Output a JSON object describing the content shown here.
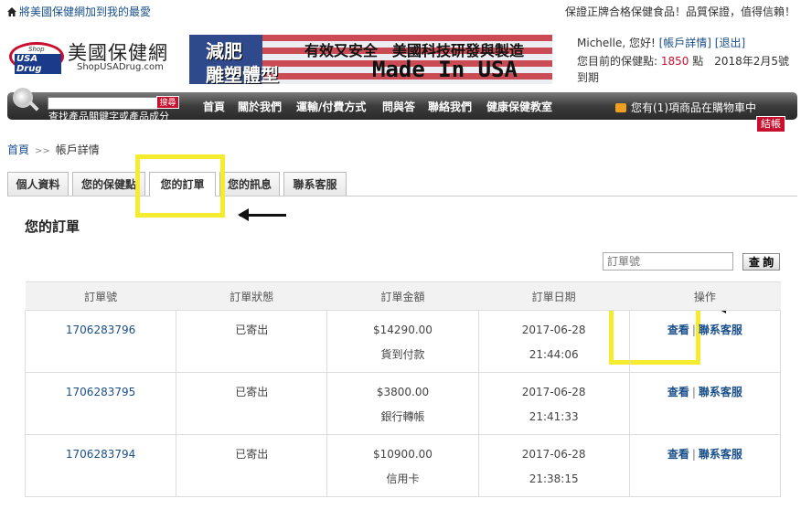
{
  "topbar": {
    "favorite_link": "將美國保健網加到我的最愛",
    "slogan": "保證正牌合格保健食品！品質保證，值得信賴！"
  },
  "logo": {
    "badge_shop": "Shop",
    "badge_usa": "USA Drug",
    "name": "美國保健網",
    "url": "ShopUSADrug.com"
  },
  "banner": {
    "line1": "減肥",
    "line2": "雕塑體型",
    "tag1": "有效又安全",
    "tag2": "美國科技研發與製造",
    "made_in": "Made In USA"
  },
  "user": {
    "greeting": "Michelle, 您好!",
    "account_link": "[帳戶詳情]",
    "logout_link": "[退出]",
    "points_label": "您目前的保健點:",
    "points_value": "1850",
    "points_suffix": "點　2018年2月5號到期"
  },
  "search": {
    "placeholder": "",
    "button": "搜尋",
    "hint": "查找產品關鍵字或產品成分"
  },
  "nav": [
    {
      "label": "首頁"
    },
    {
      "label": "關於我們"
    },
    {
      "label": "運輸/付費方式"
    },
    {
      "label": "問與答"
    },
    {
      "label": "聯絡我們"
    },
    {
      "label": "健康保健教室"
    }
  ],
  "cart": {
    "text": "您有(1)項商品在購物車中",
    "checkout": "結帳"
  },
  "breadcrumb": {
    "home": "首頁",
    "sep": ">>",
    "current": "帳戶詳情"
  },
  "tabs": [
    {
      "label": "個人資料"
    },
    {
      "label": "您的保健點"
    },
    {
      "label": "您的訂單"
    },
    {
      "label": "您的訊息"
    },
    {
      "label": "聯系客服"
    }
  ],
  "orders": {
    "title": "您的訂單",
    "search_placeholder": "訂單號",
    "query_button": "查 詢",
    "columns": [
      "訂單號",
      "訂單狀態",
      "訂單金額",
      "訂單日期",
      "操作"
    ],
    "rows": [
      {
        "id": "1706283796",
        "status": "已寄出",
        "amount": "$14290.00",
        "payment": "貨到付款",
        "date": "2017-06-28",
        "time": "21:44:06",
        "view": "查看",
        "contact": "聯系客服"
      },
      {
        "id": "1706283795",
        "status": "已寄出",
        "amount": "$3800.00",
        "payment": "銀行轉帳",
        "date": "2017-06-28",
        "time": "21:41:33",
        "view": "查看",
        "contact": "聯系客服"
      },
      {
        "id": "1706283794",
        "status": "已寄出",
        "amount": "$10900.00",
        "payment": "信用卡",
        "date": "2017-06-28",
        "time": "21:38:15",
        "view": "查看",
        "contact": "聯系客服"
      }
    ]
  },
  "colors": {
    "link": "#1a4f8a",
    "accent_red": "#c8102e",
    "highlight_yellow": "#f5ec30"
  }
}
